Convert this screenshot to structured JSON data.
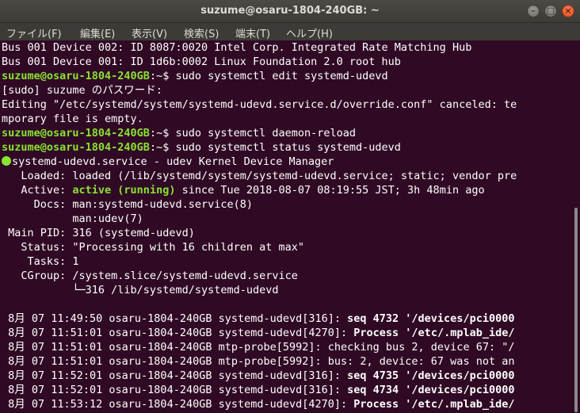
{
  "window": {
    "title": "suzume@osaru-1804-240GB: ~",
    "minimize": "–",
    "maximize": "□",
    "close": "×"
  },
  "menu": [
    "ファイル(F)",
    "編集(E)",
    "表示(V)",
    "検索(S)",
    "端末(T)",
    "ヘルプ(H)"
  ],
  "prompt": {
    "user_host": "suzume@osaru-1804-240GB",
    "path_suffix": ":~$ "
  },
  "terminal": {
    "usb1": "Bus 001 Device 002: ID 8087:0020 Intel Corp. Integrated Rate Matching Hub",
    "usb2": "Bus 001 Device 001: ID 1d6b:0002 Linux Foundation 2.0 root hub",
    "cmd1": "sudo systemctl edit systemd-udevd",
    "sudo_prompt": "[sudo] suzume のパスワード:",
    "edit_msg1": "Editing \"/etc/systemd/system/systemd-udevd.service.d/override.conf\" canceled: te",
    "edit_msg2": "mporary file is empty.",
    "cmd2": "sudo systemctl daemon-reload",
    "cmd3": "sudo systemctl status systemd-udevd",
    "svc_header": "systemd-udevd.service - udev Kernel Device Manager",
    "loaded": "   Loaded: loaded (/lib/systemd/system/systemd-udevd.service; static; vendor pre",
    "active_label": "   Active: ",
    "active_state": "active (running)",
    "active_rest": " since Tue 2018-08-07 08:19:55 JST; 3h 48min ago",
    "docs1": "     Docs: man:systemd-udevd.service(8)",
    "docs2": "           man:udev(7)",
    "mainpid": " Main PID: 316 (systemd-udevd)",
    "status": "   Status: \"Processing with 16 children at max\"",
    "tasks": "    Tasks: 1",
    "cgroup": "   CGroup: /system.slice/systemd-udevd.service",
    "cgroup_child": "           └─316 /lib/systemd/systemd-udevd"
  },
  "logs": [
    {
      "prefix": " 8月 07 11:49:50 osaru-1804-240GB systemd-udevd[316]: ",
      "bold": "seq 4732 '/devices/pci0000",
      "rest": ""
    },
    {
      "prefix": " 8月 07 11:51:01 osaru-1804-240GB systemd-udevd[4270]: ",
      "bold": "Process '/etc/.mplab_ide/",
      "rest": ""
    },
    {
      "prefix": " 8月 07 11:51:01 osaru-1804-240GB mtp-probe[5992]: checking bus 2, device 67: \"/",
      "bold": "",
      "rest": ""
    },
    {
      "prefix": " 8月 07 11:51:01 osaru-1804-240GB mtp-probe[5992]: bus: 2, device: 67 was not an",
      "bold": "",
      "rest": ""
    },
    {
      "prefix": " 8月 07 11:52:01 osaru-1804-240GB systemd-udevd[316]: ",
      "bold": "seq 4735 '/devices/pci0000",
      "rest": ""
    },
    {
      "prefix": " 8月 07 11:52:01 osaru-1804-240GB systemd-udevd[316]: ",
      "bold": "seq 4734 '/devices/pci0000",
      "rest": ""
    },
    {
      "prefix": " 8月 07 11:53:12 osaru-1804-240GB systemd-udevd[4270]: ",
      "bold": "Process '/etc/.mplab_ide/",
      "rest": ""
    }
  ],
  "colors": {
    "background": "#300a24",
    "prompt": "#8ae234",
    "text": "#ffffff"
  }
}
